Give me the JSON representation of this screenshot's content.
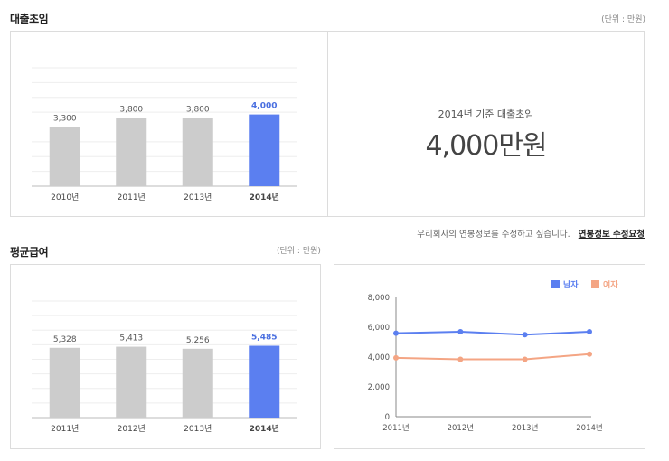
{
  "colors": {
    "bar_default": "#cccccc",
    "bar_highlight": "#5b7ff0",
    "label_default": "#555555",
    "label_highlight": "#4a6fe0",
    "male": "#5b7ff0",
    "female": "#f4a584"
  },
  "starting_salary": {
    "title": "대출초임",
    "unit": "(단위 : 만원)",
    "summary_caption": "2014년 기준 대출초임",
    "summary_value": "4,000만원"
  },
  "average_salary": {
    "title": "평균급여",
    "unit": "(단위 : 만원)"
  },
  "edit_request": {
    "note": "우리회사의 연봉정보를 수정하고 싶습니다.",
    "link": "연봉정보 수정요청"
  },
  "chart_data": [
    {
      "type": "bar",
      "categories": [
        "2010년",
        "2011년",
        "2013년",
        "2014년"
      ],
      "values": [
        3300,
        3800,
        3800,
        4000
      ],
      "value_labels": [
        "3,300",
        "3,800",
        "3,800",
        "4,000"
      ],
      "highlight_index": 3,
      "ylim": [
        0,
        6600
      ],
      "grid": true
    },
    {
      "type": "bar",
      "categories": [
        "2011년",
        "2012년",
        "2013년",
        "2014년"
      ],
      "values": [
        5328,
        5413,
        5256,
        5485
      ],
      "value_labels": [
        "5,328",
        "5,413",
        "5,256",
        "5,485"
      ],
      "highlight_index": 3,
      "ylim": [
        0,
        8900
      ],
      "grid": true
    },
    {
      "type": "line",
      "x": [
        "2011년",
        "2012년",
        "2013년",
        "2014년"
      ],
      "yticks": [
        "0",
        "2,000",
        "4,000",
        "6,000",
        "8,000"
      ],
      "ylim": [
        0,
        8000
      ],
      "legend_position": "top-right",
      "series": [
        {
          "name": "남자",
          "color_key": "male",
          "values": [
            5600,
            5700,
            5500,
            5700
          ]
        },
        {
          "name": "여자",
          "color_key": "female",
          "values": [
            3950,
            3850,
            3850,
            4200
          ]
        }
      ]
    }
  ]
}
